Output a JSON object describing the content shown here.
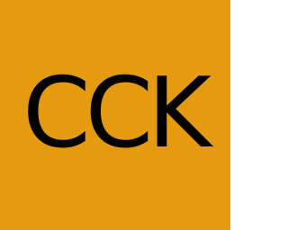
{
  "tile": {
    "text": "CCK",
    "background_color": "#E49B0F",
    "text_color": "#000000"
  }
}
